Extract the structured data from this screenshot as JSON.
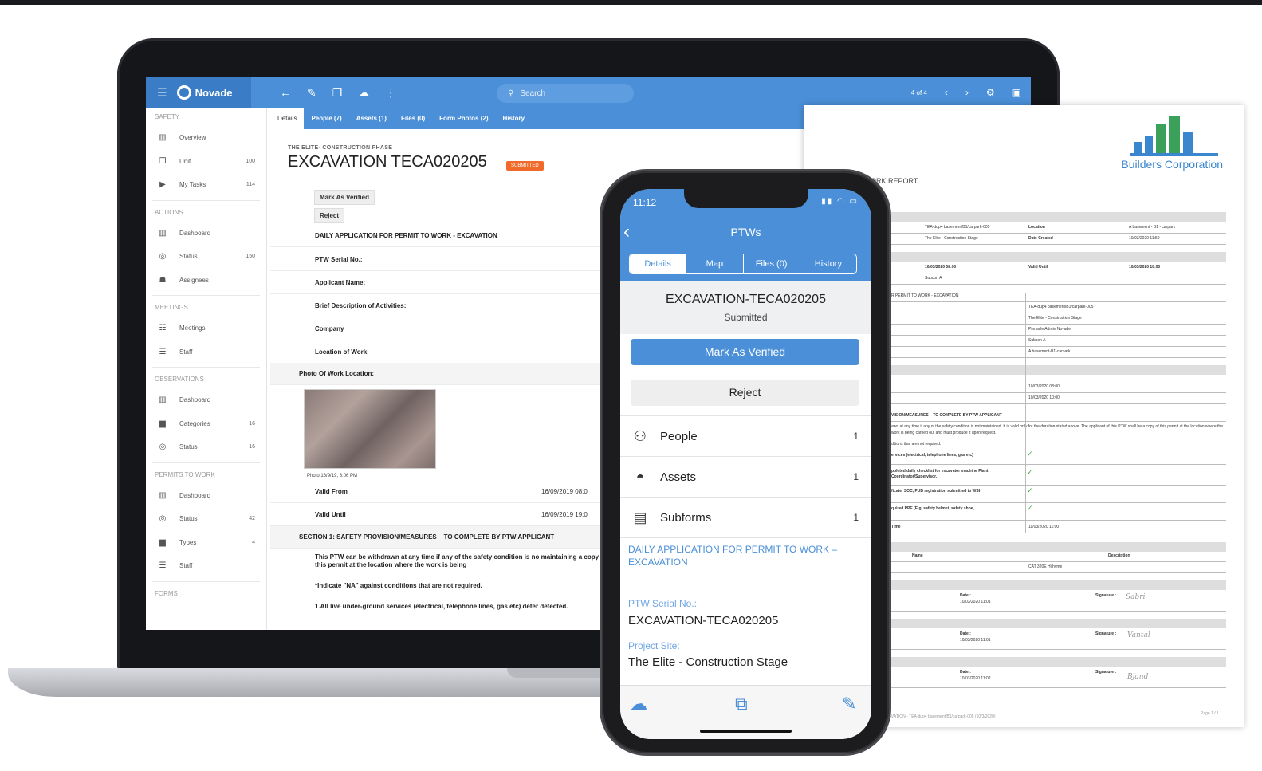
{
  "laptop": {
    "app_name": "Novade",
    "search_placeholder": "Search",
    "pager": "4 of 4",
    "sidebar": {
      "sections": [
        {
          "title": "SAFETY",
          "items": [
            {
              "label": "Overview",
              "icon": "chart-icon",
              "count": ""
            },
            {
              "label": "Unit",
              "icon": "copy-icon",
              "count": "100"
            },
            {
              "label": "My Tasks",
              "icon": "play-icon",
              "count": "114"
            }
          ]
        },
        {
          "title": "ACTIONS",
          "items": [
            {
              "label": "Dashboard",
              "icon": "chart-icon",
              "count": ""
            },
            {
              "label": "Status",
              "icon": "check-circle-icon",
              "count": "150"
            },
            {
              "label": "Assignees",
              "icon": "people-icon",
              "count": ""
            }
          ]
        },
        {
          "title": "MEETINGS",
          "items": [
            {
              "label": "Meetings",
              "icon": "meeting-icon",
              "count": ""
            },
            {
              "label": "Staff",
              "icon": "staff-icon",
              "count": ""
            }
          ]
        },
        {
          "title": "OBSERVATIONS",
          "items": [
            {
              "label": "Dashboard",
              "icon": "chart-icon",
              "count": ""
            },
            {
              "label": "Categories",
              "icon": "folder-icon",
              "count": "16"
            },
            {
              "label": "Status",
              "icon": "check-circle-icon",
              "count": "16"
            }
          ]
        },
        {
          "title": "PERMITS TO WORK",
          "items": [
            {
              "label": "Dashboard",
              "icon": "chart-icon",
              "count": ""
            },
            {
              "label": "Status",
              "icon": "check-circle-icon",
              "count": "42"
            },
            {
              "label": "Types",
              "icon": "folder-icon",
              "count": "4"
            },
            {
              "label": "Staff",
              "icon": "staff-icon",
              "count": ""
            }
          ]
        },
        {
          "title": "FORMS",
          "items": []
        }
      ]
    },
    "tabs": [
      "Details",
      "People (7)",
      "Assets (1)",
      "Files (0)",
      "Form Photos (2)",
      "History"
    ],
    "breadcrumb": "THE ELITE- CONSTRUCTION PHASE",
    "title": "EXCAVATION TECA020205",
    "badge": "SUBMITTED",
    "mark_verified": "Mark As Verified",
    "reject": "Reject",
    "form_title": "DAILY APPLICATION FOR PERMIT TO WORK - EXCAVATION",
    "fields": [
      "PTW Serial No.:",
      "Applicant Name:",
      "Brief Description of Activities:",
      "Company",
      "Location of Work:"
    ],
    "photo_label": "Photo Of Work Location:",
    "photo_caption": "Photo 16/9/19, 3:06 PM",
    "valid_from_label": "Valid From",
    "valid_from": "16/09/2019 08:0",
    "valid_until_label": "Valid Until",
    "valid_until": "16/09/2019 19:0",
    "section_title": "SECTION 1: SAFETY PROVISION/MEASURES – TO COMPLETE BY PTW APPLICANT",
    "para1": "This PTW can be withdrawn at any time if any of the safety condition is no maintaining a copy of this permit at the location where the work is being",
    "para2": "*Indicate \"NA\" against conditions that are not required.",
    "para3": "1.All live under-ground services (electrical, telephone lines, gas etc) deter detected."
  },
  "report": {
    "brand": "Builders Corporation",
    "heading": "ORK REPORT",
    "rows": [
      {
        "c1": "TEA-dup4 basement/B1/carpark-005",
        "c2": "Location",
        "c3": "A basement - B1 - carpark"
      },
      {
        "c1": "The Elite - Construction Stage",
        "c2": "Date Created",
        "c3": "10/03/2020 11:50"
      },
      {
        "c1": "10/03/2020 08:00",
        "c2": "Valid Until",
        "c3": "10/03/2020 18:00"
      },
      {
        "c1": "Subcon A",
        "c2": "",
        "c3": ""
      }
    ],
    "permit_heading": "R PERMIT TO WORK - EXCAVATION",
    "permit_rows": [
      "TEA-dup4 basement/B1/carpark-005",
      "The Elite - Construction Stage",
      "Pinnacle Admin Novade",
      "Subcon A",
      "A basement-B1-carpark"
    ],
    "date_rows": [
      "10/03/2020 08:00",
      "10/03/2020 10:00"
    ],
    "section": "VISION/MEASURES – TO COMPLETE BY PTW APPLICANT",
    "section_text": "awn at any time if any of the safety condition is not maintained. It is valid only for the duration stated above. The applicant of this PTW shall be a copy of this permit at the location where the work is being carried out and must produce it upon request.",
    "conditions": [
      "ditions that are not required.",
      "ervices (electrical, telephone lines, gas etc)",
      "ppleted daily checklist for excavator machine Plant Coordinator/Supervisor.",
      "ficate, SOC, PUB registration submitted to WSH",
      "quired PPE (E.g. safety helmet, safety shoe,",
      "Time"
    ],
    "time_value": "11/03/2020 11:00",
    "name_col": "Name",
    "desc_col": "Description",
    "asset": "CAT 320E Hi hyme",
    "date_label": "Date :",
    "signature_label": "Signature :",
    "sig_dates": [
      "10/03/2020 11:01",
      "10/03/2020 11:01",
      "10/03/2020 11:02"
    ],
    "footer_left": "XCAVATION - TEA-dup4 basement/B1/carpark-005 (10/3/2020)",
    "footer_right": "Page 1 / 1"
  },
  "phone": {
    "time": "11:12",
    "title": "PTWs",
    "tabs": [
      "Details",
      "Map",
      "Files (0)",
      "History"
    ],
    "id": "EXCAVATION-TECA020205",
    "status": "Submitted",
    "mark_verified": "Mark As Verified",
    "reject": "Reject",
    "rows": [
      {
        "label": "People",
        "count": "1",
        "icon": "people-icon"
      },
      {
        "label": "Assets",
        "count": "1",
        "icon": "hardhat-icon"
      },
      {
        "label": "Subforms",
        "count": "1",
        "icon": "document-icon"
      }
    ],
    "form_link": "DAILY APPLICATION FOR PERMIT TO WORK – EXCAVATION",
    "serial_label": "PTW Serial No.:",
    "serial_value": "EXCAVATION-TECA020205",
    "site_label": "Project Site:",
    "site_value": "The Elite - Construction Stage"
  },
  "colors": {
    "accent": "#4a8fd8",
    "badge": "#f06a2a",
    "check": "#3aa33a"
  }
}
